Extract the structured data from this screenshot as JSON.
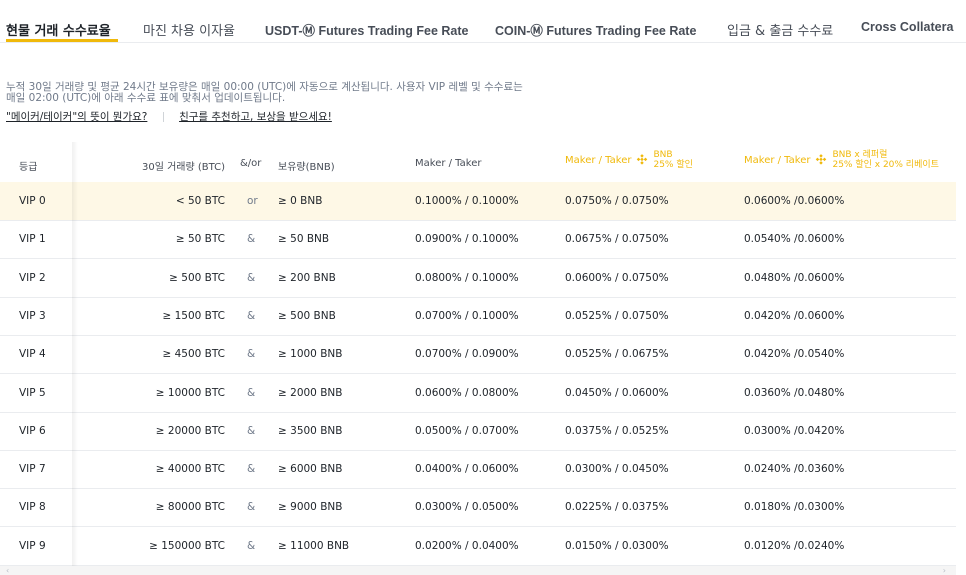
{
  "tabs": [
    {
      "label": "현물 거래 수수료율",
      "active": true
    },
    {
      "label": "마진 차용 이자율"
    },
    {
      "label": "USDT-Ⓜ Futures Trading Fee Rate"
    },
    {
      "label": "COIN-Ⓜ Futures Trading Fee Rate"
    },
    {
      "label": "입금 & 출금 수수료"
    },
    {
      "label": "Cross Collatera"
    }
  ],
  "intro": {
    "line1": "누적 30일 거래량 및 평균 24시간 보유량은 매일 00:00 (UTC)에 자동으로 계산됩니다. 사용자 VIP 레벨 및 수수료는",
    "line2": "매일 02:00 (UTC)에 아래 수수료 표에 맞춰서 업데이트됩니다."
  },
  "links": {
    "maker_taker": "\"메이커/테이커\"의 뜻이 뭔가요?",
    "referral": "친구를 추천하고, 보상을 받으세요!"
  },
  "table": {
    "headers": {
      "tier": "등급",
      "volume": "30일 거래량 (BTC)",
      "andor": "&/or",
      "bnb_hold": "보유량(BNB)",
      "maker_taker": "Maker / Taker",
      "maker_taker_bnb": "Maker / Taker",
      "bnb_discount_1": "BNB",
      "bnb_discount_2": "25% 할인",
      "maker_taker_bnb_ref": "Maker / Taker",
      "bnb_ref_1": "BNB x 레퍼럴",
      "bnb_ref_2": "25% 할인 x 20% 리베이트"
    },
    "rows": [
      {
        "tier": "VIP 0",
        "volume": "< 50 BTC",
        "op": "or",
        "bnb": "≥ 0 BNB",
        "mt": "0.1000% / 0.1000%",
        "bnbd": "0.0750% / 0.0750%",
        "bnbr": "0.0600% /0.0600%"
      },
      {
        "tier": "VIP 1",
        "volume": "≥ 50 BTC",
        "op": "&",
        "bnb": "≥ 50 BNB",
        "mt": "0.0900% / 0.1000%",
        "bnbd": "0.0675% / 0.0750%",
        "bnbr": "0.0540% /0.0600%"
      },
      {
        "tier": "VIP 2",
        "volume": "≥ 500 BTC",
        "op": "&",
        "bnb": "≥ 200 BNB",
        "mt": "0.0800% / 0.1000%",
        "bnbd": "0.0600% / 0.0750%",
        "bnbr": "0.0480% /0.0600%"
      },
      {
        "tier": "VIP 3",
        "volume": "≥ 1500 BTC",
        "op": "&",
        "bnb": "≥ 500 BNB",
        "mt": "0.0700% / 0.1000%",
        "bnbd": "0.0525% / 0.0750%",
        "bnbr": "0.0420% /0.0600%"
      },
      {
        "tier": "VIP 4",
        "volume": "≥ 4500 BTC",
        "op": "&",
        "bnb": "≥ 1000 BNB",
        "mt": "0.0700% / 0.0900%",
        "bnbd": "0.0525% / 0.0675%",
        "bnbr": "0.0420% /0.0540%"
      },
      {
        "tier": "VIP 5",
        "volume": "≥ 10000 BTC",
        "op": "&",
        "bnb": "≥ 2000 BNB",
        "mt": "0.0600% / 0.0800%",
        "bnbd": "0.0450% / 0.0600%",
        "bnbr": "0.0360% /0.0480%"
      },
      {
        "tier": "VIP 6",
        "volume": "≥ 20000 BTC",
        "op": "&",
        "bnb": "≥ 3500 BNB",
        "mt": "0.0500% / 0.0700%",
        "bnbd": "0.0375% / 0.0525%",
        "bnbr": "0.0300% /0.0420%"
      },
      {
        "tier": "VIP 7",
        "volume": "≥ 40000 BTC",
        "op": "&",
        "bnb": "≥ 6000 BNB",
        "mt": "0.0400% / 0.0600%",
        "bnbd": "0.0300% / 0.0450%",
        "bnbr": "0.0240% /0.0360%"
      },
      {
        "tier": "VIP 8",
        "volume": "≥ 80000 BTC",
        "op": "&",
        "bnb": "≥ 9000 BNB",
        "mt": "0.0300% / 0.0500%",
        "bnbd": "0.0225% / 0.0375%",
        "bnbr": "0.0180% /0.0300%"
      },
      {
        "tier": "VIP 9",
        "volume": "≥ 150000 BTC",
        "op": "&",
        "bnb": "≥ 11000 BNB",
        "mt": "0.0200% / 0.0400%",
        "bnbd": "0.0150% / 0.0300%",
        "bnbr": "0.0120% /0.0240%"
      }
    ]
  },
  "scroll": {
    "left_arrow": "‹",
    "right_arrow": "›"
  },
  "colors": {
    "accent": "#f0b90b",
    "highlight_row": "#fef8e6",
    "text": "#1e2329",
    "muted": "#707a8a"
  }
}
